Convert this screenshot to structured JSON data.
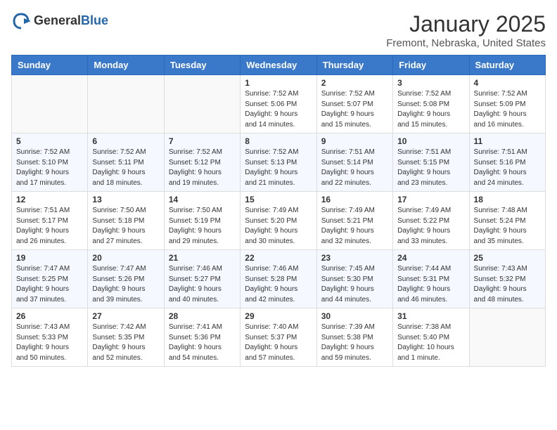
{
  "header": {
    "logo_general": "General",
    "logo_blue": "Blue",
    "month_title": "January 2025",
    "location": "Fremont, Nebraska, United States"
  },
  "days_of_week": [
    "Sunday",
    "Monday",
    "Tuesday",
    "Wednesday",
    "Thursday",
    "Friday",
    "Saturday"
  ],
  "weeks": [
    [
      {
        "day": "",
        "info": ""
      },
      {
        "day": "",
        "info": ""
      },
      {
        "day": "",
        "info": ""
      },
      {
        "day": "1",
        "info": "Sunrise: 7:52 AM\nSunset: 5:06 PM\nDaylight: 9 hours\nand 14 minutes."
      },
      {
        "day": "2",
        "info": "Sunrise: 7:52 AM\nSunset: 5:07 PM\nDaylight: 9 hours\nand 15 minutes."
      },
      {
        "day": "3",
        "info": "Sunrise: 7:52 AM\nSunset: 5:08 PM\nDaylight: 9 hours\nand 15 minutes."
      },
      {
        "day": "4",
        "info": "Sunrise: 7:52 AM\nSunset: 5:09 PM\nDaylight: 9 hours\nand 16 minutes."
      }
    ],
    [
      {
        "day": "5",
        "info": "Sunrise: 7:52 AM\nSunset: 5:10 PM\nDaylight: 9 hours\nand 17 minutes."
      },
      {
        "day": "6",
        "info": "Sunrise: 7:52 AM\nSunset: 5:11 PM\nDaylight: 9 hours\nand 18 minutes."
      },
      {
        "day": "7",
        "info": "Sunrise: 7:52 AM\nSunset: 5:12 PM\nDaylight: 9 hours\nand 19 minutes."
      },
      {
        "day": "8",
        "info": "Sunrise: 7:52 AM\nSunset: 5:13 PM\nDaylight: 9 hours\nand 21 minutes."
      },
      {
        "day": "9",
        "info": "Sunrise: 7:51 AM\nSunset: 5:14 PM\nDaylight: 9 hours\nand 22 minutes."
      },
      {
        "day": "10",
        "info": "Sunrise: 7:51 AM\nSunset: 5:15 PM\nDaylight: 9 hours\nand 23 minutes."
      },
      {
        "day": "11",
        "info": "Sunrise: 7:51 AM\nSunset: 5:16 PM\nDaylight: 9 hours\nand 24 minutes."
      }
    ],
    [
      {
        "day": "12",
        "info": "Sunrise: 7:51 AM\nSunset: 5:17 PM\nDaylight: 9 hours\nand 26 minutes."
      },
      {
        "day": "13",
        "info": "Sunrise: 7:50 AM\nSunset: 5:18 PM\nDaylight: 9 hours\nand 27 minutes."
      },
      {
        "day": "14",
        "info": "Sunrise: 7:50 AM\nSunset: 5:19 PM\nDaylight: 9 hours\nand 29 minutes."
      },
      {
        "day": "15",
        "info": "Sunrise: 7:49 AM\nSunset: 5:20 PM\nDaylight: 9 hours\nand 30 minutes."
      },
      {
        "day": "16",
        "info": "Sunrise: 7:49 AM\nSunset: 5:21 PM\nDaylight: 9 hours\nand 32 minutes."
      },
      {
        "day": "17",
        "info": "Sunrise: 7:49 AM\nSunset: 5:22 PM\nDaylight: 9 hours\nand 33 minutes."
      },
      {
        "day": "18",
        "info": "Sunrise: 7:48 AM\nSunset: 5:24 PM\nDaylight: 9 hours\nand 35 minutes."
      }
    ],
    [
      {
        "day": "19",
        "info": "Sunrise: 7:47 AM\nSunset: 5:25 PM\nDaylight: 9 hours\nand 37 minutes."
      },
      {
        "day": "20",
        "info": "Sunrise: 7:47 AM\nSunset: 5:26 PM\nDaylight: 9 hours\nand 39 minutes."
      },
      {
        "day": "21",
        "info": "Sunrise: 7:46 AM\nSunset: 5:27 PM\nDaylight: 9 hours\nand 40 minutes."
      },
      {
        "day": "22",
        "info": "Sunrise: 7:46 AM\nSunset: 5:28 PM\nDaylight: 9 hours\nand 42 minutes."
      },
      {
        "day": "23",
        "info": "Sunrise: 7:45 AM\nSunset: 5:30 PM\nDaylight: 9 hours\nand 44 minutes."
      },
      {
        "day": "24",
        "info": "Sunrise: 7:44 AM\nSunset: 5:31 PM\nDaylight: 9 hours\nand 46 minutes."
      },
      {
        "day": "25",
        "info": "Sunrise: 7:43 AM\nSunset: 5:32 PM\nDaylight: 9 hours\nand 48 minutes."
      }
    ],
    [
      {
        "day": "26",
        "info": "Sunrise: 7:43 AM\nSunset: 5:33 PM\nDaylight: 9 hours\nand 50 minutes."
      },
      {
        "day": "27",
        "info": "Sunrise: 7:42 AM\nSunset: 5:35 PM\nDaylight: 9 hours\nand 52 minutes."
      },
      {
        "day": "28",
        "info": "Sunrise: 7:41 AM\nSunset: 5:36 PM\nDaylight: 9 hours\nand 54 minutes."
      },
      {
        "day": "29",
        "info": "Sunrise: 7:40 AM\nSunset: 5:37 PM\nDaylight: 9 hours\nand 57 minutes."
      },
      {
        "day": "30",
        "info": "Sunrise: 7:39 AM\nSunset: 5:38 PM\nDaylight: 9 hours\nand 59 minutes."
      },
      {
        "day": "31",
        "info": "Sunrise: 7:38 AM\nSunset: 5:40 PM\nDaylight: 10 hours\nand 1 minute."
      },
      {
        "day": "",
        "info": ""
      }
    ]
  ]
}
